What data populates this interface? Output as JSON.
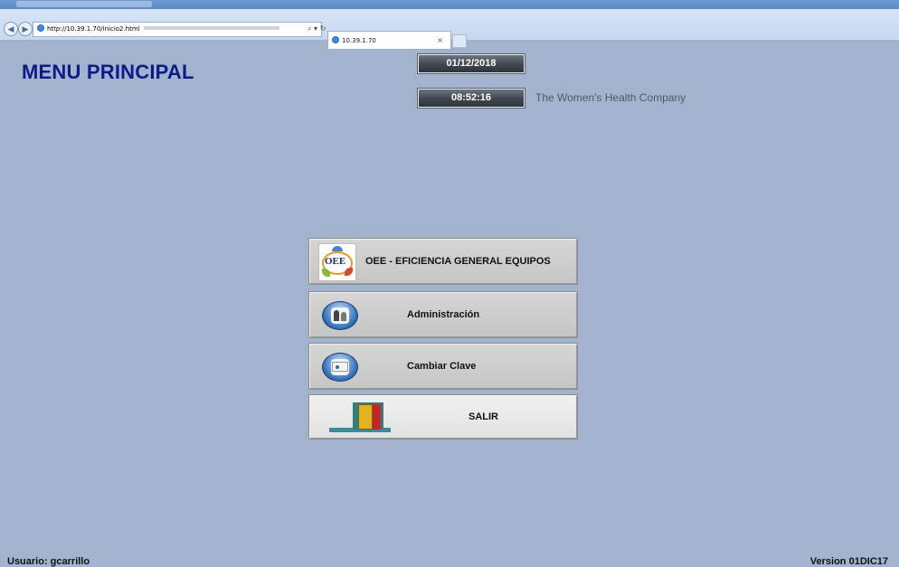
{
  "browser": {
    "address": "http://10.39.1.70/inicio2.html",
    "tab_title": "10.39.1.70",
    "search_glyph": "⌕ ▾ ↻",
    "tab_close": "×"
  },
  "page": {
    "title": "MENU PRINCIPAL",
    "date": "01/12/2018",
    "time": "08:52:16",
    "company": "The Women's Health Company"
  },
  "menu": {
    "oee_label": "OEE - EFICIENCIA GENERAL EQUIPOS",
    "oee_icon_text": "OEE",
    "admin_label": "Administración",
    "password_label": "Cambiar Clave",
    "exit_label": "SALIR"
  },
  "footer": {
    "user": "Usuario: gcarrillo",
    "version": "Version 01DIC17"
  },
  "colors": {
    "background": "#a2b4cd",
    "title": "#0c1b8c"
  }
}
